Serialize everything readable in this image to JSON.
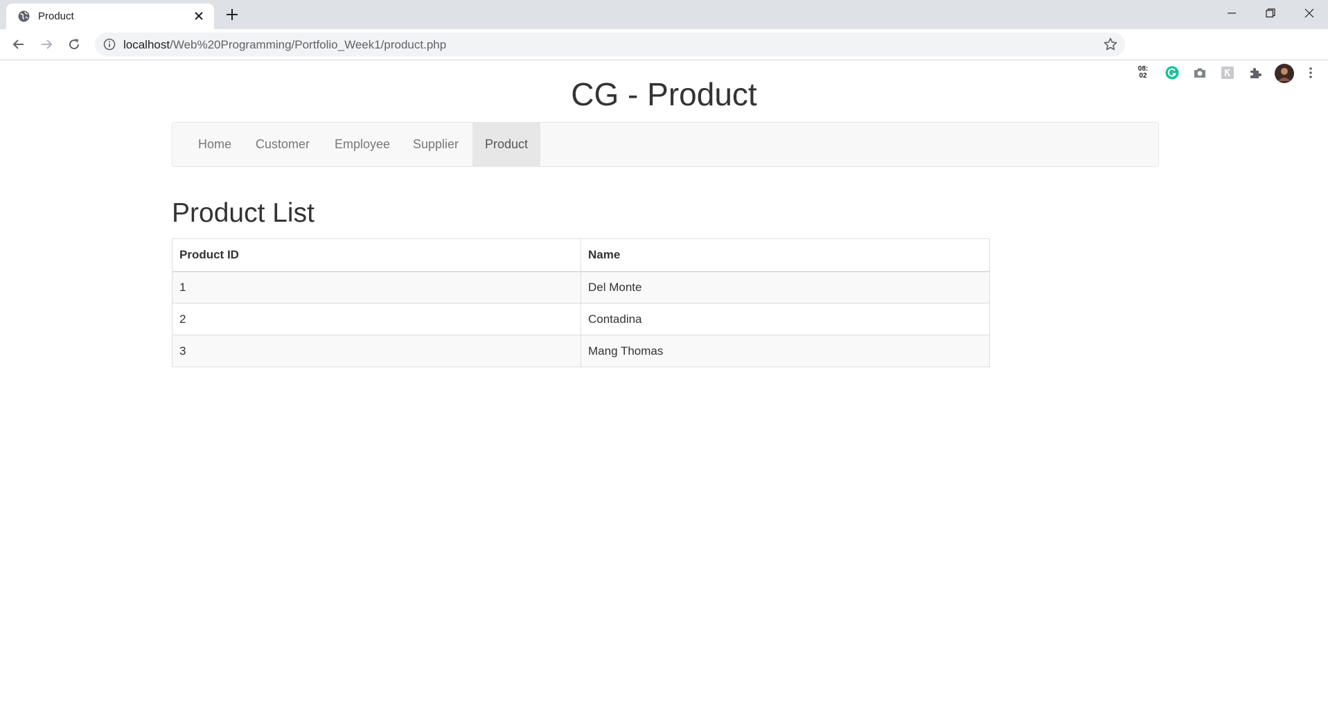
{
  "browser": {
    "tab_title": "Product",
    "url_host": "localhost",
    "url_path": "/Web%20Programming/Portfolio_Week1/product.php",
    "extension_clock": "08:\n02"
  },
  "page": {
    "title": "CG - Product",
    "nav": [
      {
        "label": "Home",
        "active": false
      },
      {
        "label": "Customer",
        "active": false
      },
      {
        "label": "Employee",
        "active": false
      },
      {
        "label": "Supplier",
        "active": false
      },
      {
        "label": "Product",
        "active": true
      }
    ],
    "section_title": "Product List",
    "table": {
      "headers": [
        "Product ID",
        "Name"
      ],
      "rows": [
        [
          "1",
          "Del Monte"
        ],
        [
          "2",
          "Contadina"
        ],
        [
          "3",
          "Mang Thomas"
        ]
      ]
    }
  },
  "colors": {
    "tabstrip": "#dee1e6",
    "navbar_bg": "#f8f8f8",
    "nav_active_bg": "#e7e7e7",
    "grammarly_green": "#15c39a"
  }
}
